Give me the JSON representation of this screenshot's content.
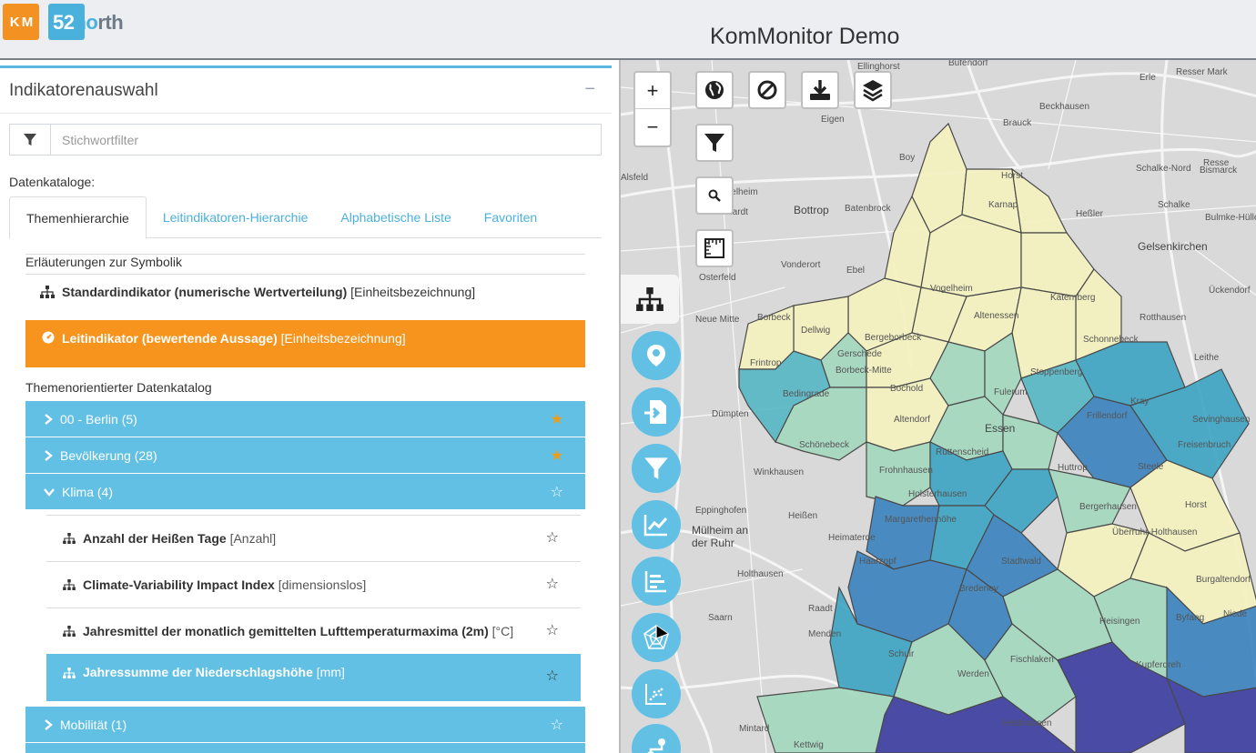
{
  "header": {
    "logo_kom": "K M",
    "logo_52": "52",
    "logo_no": "no",
    "logo_rth": "rth",
    "title": "KomMonitor Demo"
  },
  "panel": {
    "title": "Indikatorenauswahl",
    "collapse": "−",
    "filter_placeholder": "Stichwortfilter",
    "catalog_label": "Datenkataloge:",
    "tabs": [
      "Themenhierarchie",
      "Leitindikatoren-Hierarchie",
      "Alphabetische Liste",
      "Favoriten"
    ],
    "legend": {
      "title": "Erläuterungen zur Symbolik",
      "standard_bold": "Standardindikator (numerische Wertverteilung)",
      "standard_unit": "[Einheitsbezeichnung]",
      "lead_bold": "Leitindikator (bewertende Aussage)",
      "lead_unit": "[Einheitsbezeichnung]"
    },
    "catalog_title": "Themenorientierter Datenkatalog",
    "categories": [
      {
        "label": "00 - Berlin (5)",
        "starred": true
      },
      {
        "label": "Bevölkerung (28)",
        "starred": true
      },
      {
        "label": "Klima (4)",
        "starred": false
      },
      {
        "label": "Mobilität (1)",
        "starred": false
      }
    ],
    "indicators": [
      {
        "name": "Anzahl der Heißen Tage",
        "unit": "[Anzahl]"
      },
      {
        "name": "Climate-Variability Impact Index",
        "unit": "[dimensionslos]"
      },
      {
        "name": "Jahresmittel der monatlich gemittelten Lufttemperaturmaxima (2m)",
        "unit": "[°C]"
      },
      {
        "name": "Jahressumme der Niederschlagshöhe",
        "unit": "[mm]"
      }
    ],
    "star_filled": "★",
    "star_empty": "☆"
  },
  "map": {
    "zoom_in": "+",
    "zoom_out": "−",
    "labels": [
      "Ellinghorst",
      "Bufendorf",
      "Resser Mark",
      "Erle",
      "Beckhausen",
      "Brauck",
      "Eigen",
      "Boy",
      "Horst",
      "Schalke-Nord",
      "Resse",
      "Bismarck",
      "Schalke",
      "Bulmke-Hülle",
      "Heßler",
      "Gelsenkirchen",
      "Bottrop",
      "Batenbrock",
      "Ückendorf",
      "Rotthausen",
      "Vonderort",
      "Ebel",
      "Osterfeld",
      "Leithe",
      "Sevinghausen",
      "Borbeck",
      "Neue Mitte",
      "Essen",
      "Dümpten",
      "Winkhausen",
      "Eppinghofen",
      "Heißen",
      "Mülheim an der Ruhr",
      "Heimaterde",
      "Holthausen",
      "Saarn",
      "Raadt",
      "Menden",
      "Mintard",
      "Kettwig",
      "Niede",
      "Horst",
      "Freisenbruch",
      "Steele",
      "Huttrop",
      "Bergerhausen",
      "Überruhr-Holthausen",
      "Burgaltendorf",
      "Byfang",
      "Heisingen",
      "Stadtwald",
      "Bredeney",
      "Haarzopf",
      "Schuir",
      "Fischlaken",
      "Werden",
      "Heidhausen",
      "Kupferdreh",
      "Frillendorf",
      "Kray",
      "Stoppenberg",
      "Katernberg",
      "Schonnebeck",
      "Altenessen",
      "Karnap",
      "Frintrop",
      "Bedingrade",
      "Schönebeck",
      "Frohnhausen",
      "Holsterhausen",
      "Margarethenhöhe",
      "Altendorf",
      "Gerschede",
      "Dellwig",
      "Borbeck-Mitte",
      "Bochold",
      "Bergeborbeck",
      "Vogelheim",
      "Klosterhardt",
      "Alsfeld",
      "Welheim",
      "Fulerum",
      "Rüttenscheid"
    ]
  }
}
